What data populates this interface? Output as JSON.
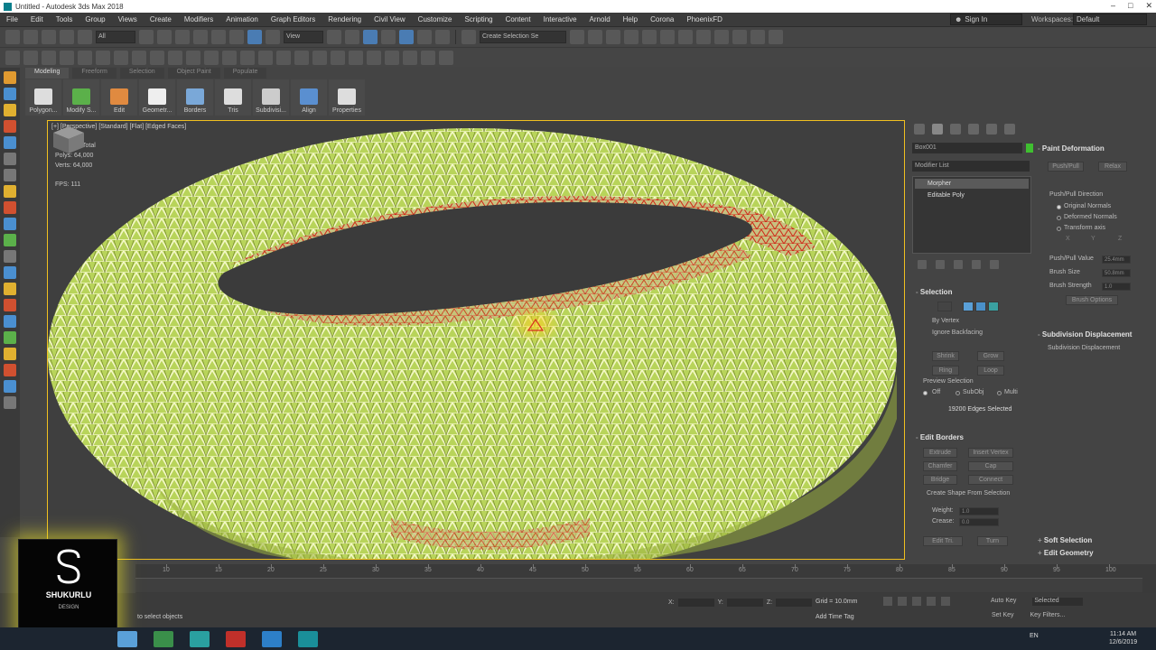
{
  "window": {
    "title": "Untitled - Autodesk 3ds Max 2018"
  },
  "menubar": {
    "items": [
      "File",
      "Edit",
      "Tools",
      "Group",
      "Views",
      "Create",
      "Modifiers",
      "Animation",
      "Graph Editors",
      "Rendering",
      "Civil View",
      "Customize",
      "Scripting",
      "Content",
      "Interactive",
      "Arnold",
      "Help",
      "Corona",
      "PhoenixFD"
    ],
    "signin": "Sign In",
    "workspace_label": "Workspaces:",
    "workspace_value": "Default"
  },
  "toolbar": {
    "filter_all": "All",
    "view_drop": "View",
    "create_selection_set": "Create Selection Se"
  },
  "ribbon": {
    "tabs": [
      "Modeling",
      "Freeform",
      "Selection",
      "Object Paint",
      "Populate"
    ],
    "buttons": [
      "Polygon...",
      "Modify S...",
      "Edit",
      "Geometr...",
      "Borders",
      "Tris",
      "Subdivisi...",
      "Align",
      "Properties"
    ]
  },
  "viewport": {
    "label": "[+] [Perspective] [Standard] [Flat] [Edged Faces]",
    "stats_total": "Total",
    "stats_polys": "Polys:   64,000",
    "stats_verts": "Verts:   64,000",
    "stats_fps": "FPS:     111"
  },
  "command_panel": {
    "object_name": "Box001",
    "modifier_list": "Modifier List",
    "stack": [
      "Morpher",
      "Editable Poly"
    ],
    "selection": {
      "title": "Selection",
      "by_vertex": "By Vertex",
      "ignore_backfacing": "Ignore Backfacing",
      "shrink": "Shrink",
      "grow": "Grow",
      "ring": "Ring",
      "loop": "Loop",
      "preview_selection": "Preview Selection",
      "off": "Off",
      "subobj": "SubObj",
      "multi": "Multi",
      "status": "19200 Edges Selected"
    },
    "edit_borders": {
      "title": "Edit Borders",
      "extrude": "Extrude",
      "insert_vertex": "Insert Vertex",
      "chamfer": "Chamfer",
      "cap": "Cap",
      "bridge": "Bridge",
      "connect": "Connect",
      "create_shape": "Create Shape From Selection",
      "weight_label": "Weight:",
      "weight_value": "1.0",
      "crease_label": "Crease:",
      "crease_value": "0.0",
      "edit_tri": "Edit Tri.",
      "turn": "Turn"
    },
    "paint_deformation": {
      "title": "Paint Deformation",
      "push_pull": "Push/Pull",
      "relax": "Relax",
      "direction": "Push/Pull Direction",
      "original_normals": "Original Normals",
      "deformed_normals": "Deformed Normals",
      "transform_axis": "Transform axis",
      "x": "X",
      "y": "Y",
      "z": "Z",
      "push_pull_value": "Push/Pull Value",
      "push_pull_value_val": "25.4mm",
      "brush_size": "Brush Size",
      "brush_size_val": "50.8mm",
      "brush_strength": "Brush Strength",
      "brush_strength_val": "1.0",
      "brush_options": "Brush Options"
    },
    "subdivision_displacement": {
      "title": "Subdivision Displacement",
      "checkbox": "Subdivision Displacement"
    },
    "soft_selection": "Soft Selection",
    "edit_geometry": "Edit Geometry"
  },
  "timeline": {
    "ticks": [
      "10",
      "15",
      "20",
      "25",
      "30",
      "35",
      "40",
      "45",
      "50",
      "55",
      "60",
      "65",
      "70",
      "75",
      "80",
      "85",
      "90",
      "95",
      "100"
    ]
  },
  "status": {
    "prompt": "to select objects",
    "add_time_tag": "Add Time Tag",
    "grid": "Grid = 10.0mm",
    "x_label": "X:",
    "y_label": "Y:",
    "z_label": "Z:",
    "auto_key": "Auto Key",
    "selected": "Selected",
    "set_key": "Set Key",
    "key_filters": "Key Filters..."
  },
  "logo": {
    "brand": "SHUKURLU",
    "sub": "DESIGN"
  },
  "taskbar": {
    "lang": "EN",
    "time": "11:14 AM",
    "date": "12/6/2019"
  },
  "colors": {
    "viewport_border": "#f0c020",
    "mesh_fill": "#c8e060",
    "mesh_edges_sel": "#e03020",
    "accent_blue": "#4a7cb3"
  }
}
